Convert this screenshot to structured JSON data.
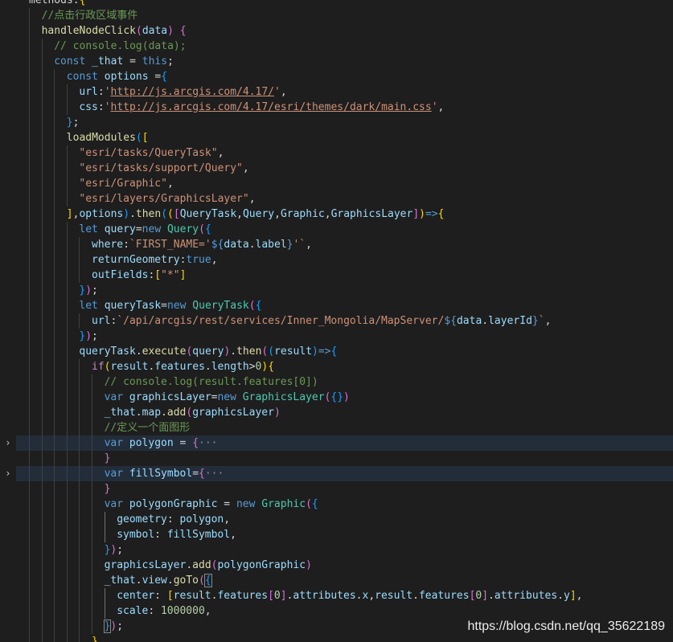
{
  "editor": {
    "lines": [
      {
        "i": 0,
        "segs": [
          [
            "op",
            "methods:"
          ],
          [
            "b1",
            "{"
          ]
        ]
      },
      {
        "i": 1,
        "segs": [
          [
            "cmt",
            "//点击行政区域事件"
          ]
        ]
      },
      {
        "i": 1,
        "segs": [
          [
            "fn",
            "handleNodeClick"
          ],
          [
            "b2",
            "("
          ],
          [
            "var",
            "data"
          ],
          [
            "b2",
            ")"
          ],
          [
            "op",
            " "
          ],
          [
            "b2",
            "{"
          ]
        ]
      },
      {
        "i": 2,
        "segs": [
          [
            "cmt",
            "// console.log(data);"
          ]
        ]
      },
      {
        "i": 2,
        "segs": [
          [
            "kw",
            "const"
          ],
          [
            "op",
            " "
          ],
          [
            "var",
            "_that"
          ],
          [
            "op",
            " = "
          ],
          [
            "kw",
            "this"
          ],
          [
            "op",
            ";"
          ]
        ]
      },
      {
        "i": 3,
        "segs": [
          [
            "kw",
            "const"
          ],
          [
            "op",
            " "
          ],
          [
            "var",
            "options"
          ],
          [
            "op",
            " ="
          ],
          [
            "b3",
            "{"
          ]
        ]
      },
      {
        "i": 4,
        "segs": [
          [
            "var",
            "url"
          ],
          [
            "op",
            ":"
          ],
          [
            "str",
            "'"
          ],
          [
            "str url",
            "http://js.arcgis.com/4.17/"
          ],
          [
            "str",
            "'"
          ],
          [
            "op",
            ","
          ]
        ]
      },
      {
        "i": 4,
        "segs": [
          [
            "var",
            "css"
          ],
          [
            "op",
            ":"
          ],
          [
            "str",
            "'"
          ],
          [
            "str url",
            "http://js.arcgis.com/4.17/esri/themes/dark/main.css"
          ],
          [
            "str",
            "'"
          ],
          [
            "op",
            ","
          ]
        ]
      },
      {
        "i": 3,
        "segs": [
          [
            "b3",
            "}"
          ],
          [
            "op",
            ";"
          ]
        ]
      },
      {
        "i": 3,
        "segs": [
          [
            "fn",
            "loadModules"
          ],
          [
            "b3",
            "("
          ],
          [
            "b1",
            "["
          ]
        ]
      },
      {
        "i": 4,
        "segs": [
          [
            "str",
            "\"esri/tasks/QueryTask\""
          ],
          [
            "op",
            ","
          ]
        ]
      },
      {
        "i": 4,
        "segs": [
          [
            "str",
            "\"esri/tasks/support/Query\""
          ],
          [
            "op",
            ","
          ]
        ]
      },
      {
        "i": 4,
        "segs": [
          [
            "str",
            "\"esri/Graphic\""
          ],
          [
            "op",
            ","
          ]
        ]
      },
      {
        "i": 4,
        "segs": [
          [
            "str",
            "\"esri/layers/GraphicsLayer\""
          ],
          [
            "op",
            ","
          ]
        ]
      },
      {
        "i": 3,
        "segs": [
          [
            "b1",
            "]"
          ],
          [
            "op",
            ","
          ],
          [
            "var",
            "options"
          ],
          [
            "b3",
            ")"
          ],
          [
            "op",
            "."
          ],
          [
            "fn",
            "then"
          ],
          [
            "b3",
            "("
          ],
          [
            "b1",
            "("
          ],
          [
            "b2",
            "["
          ],
          [
            "var",
            "QueryTask"
          ],
          [
            "op",
            ","
          ],
          [
            "var",
            "Query"
          ],
          [
            "op",
            ","
          ],
          [
            "var",
            "Graphic"
          ],
          [
            "op",
            ","
          ],
          [
            "var",
            "GraphicsLayer"
          ],
          [
            "b2",
            "]"
          ],
          [
            "b1",
            ")"
          ],
          [
            "kw",
            "=>"
          ],
          [
            "b1",
            "{"
          ]
        ]
      },
      {
        "i": 4,
        "segs": [
          [
            "kw",
            "let"
          ],
          [
            "op",
            " "
          ],
          [
            "var",
            "query"
          ],
          [
            "op",
            "="
          ],
          [
            "kw",
            "new"
          ],
          [
            "op",
            " "
          ],
          [
            "cls",
            "Query"
          ],
          [
            "b2",
            "("
          ],
          [
            "b3",
            "{"
          ]
        ]
      },
      {
        "i": 5,
        "segs": [
          [
            "var",
            "where"
          ],
          [
            "op",
            ":"
          ],
          [
            "str",
            "`FIRST_NAME='"
          ],
          [
            "kw",
            "${"
          ],
          [
            "var",
            "data"
          ],
          [
            "op",
            "."
          ],
          [
            "var",
            "label"
          ],
          [
            "kw",
            "}"
          ],
          [
            "str",
            "'`"
          ],
          [
            "op",
            ","
          ]
        ]
      },
      {
        "i": 5,
        "segs": [
          [
            "var",
            "returnGeometry"
          ],
          [
            "op",
            ":"
          ],
          [
            "kw",
            "true"
          ],
          [
            "op",
            ","
          ]
        ]
      },
      {
        "i": 5,
        "segs": [
          [
            "var",
            "outFields"
          ],
          [
            "op",
            ":"
          ],
          [
            "b1",
            "["
          ],
          [
            "str",
            "\"*\""
          ],
          [
            "b1",
            "]"
          ]
        ]
      },
      {
        "i": 4,
        "segs": [
          [
            "b3",
            "}"
          ],
          [
            "b2",
            ")"
          ],
          [
            "op",
            ";"
          ]
        ]
      },
      {
        "i": 4,
        "segs": [
          [
            "kw",
            "let"
          ],
          [
            "op",
            " "
          ],
          [
            "var",
            "queryTask"
          ],
          [
            "op",
            "="
          ],
          [
            "kw",
            "new"
          ],
          [
            "op",
            " "
          ],
          [
            "cls",
            "QueryTask"
          ],
          [
            "b2",
            "("
          ],
          [
            "b3",
            "{"
          ]
        ]
      },
      {
        "i": 5,
        "segs": [
          [
            "var",
            "url"
          ],
          [
            "op",
            ":"
          ],
          [
            "str",
            "`/api/arcgis/rest/services/Inner_Mongolia/MapServer/"
          ],
          [
            "kw",
            "${"
          ],
          [
            "var",
            "data"
          ],
          [
            "op",
            "."
          ],
          [
            "var",
            "layerId"
          ],
          [
            "kw",
            "}"
          ],
          [
            "str",
            "`"
          ],
          [
            "op",
            ","
          ]
        ]
      },
      {
        "i": 4,
        "segs": [
          [
            "b3",
            "}"
          ],
          [
            "b2",
            ")"
          ],
          [
            "op",
            ";"
          ]
        ]
      },
      {
        "i": 4,
        "segs": [
          [
            "var",
            "queryTask"
          ],
          [
            "op",
            "."
          ],
          [
            "fn",
            "execute"
          ],
          [
            "b2",
            "("
          ],
          [
            "var",
            "query"
          ],
          [
            "b2",
            ")"
          ],
          [
            "op",
            "."
          ],
          [
            "fn",
            "then"
          ],
          [
            "b2",
            "("
          ],
          [
            "b3",
            "("
          ],
          [
            "var",
            "result"
          ],
          [
            "b3",
            ")"
          ],
          [
            "kw",
            "=>"
          ],
          [
            "b3",
            "{"
          ]
        ]
      },
      {
        "i": 5,
        "segs": [
          [
            "ctl",
            "if"
          ],
          [
            "b1",
            "("
          ],
          [
            "var",
            "result"
          ],
          [
            "op",
            "."
          ],
          [
            "var",
            "features"
          ],
          [
            "op",
            "."
          ],
          [
            "var",
            "length"
          ],
          [
            "op",
            ">"
          ],
          [
            "num",
            "0"
          ],
          [
            "b1",
            ")"
          ],
          [
            "b1",
            "{"
          ]
        ]
      },
      {
        "i": 6,
        "segs": [
          [
            "cmt",
            "// console.log(result.features[0])"
          ]
        ]
      },
      {
        "i": 6,
        "segs": [
          [
            "kw",
            "var"
          ],
          [
            "op",
            " "
          ],
          [
            "var",
            "graphicsLayer"
          ],
          [
            "op",
            "="
          ],
          [
            "kw",
            "new"
          ],
          [
            "op",
            " "
          ],
          [
            "cls",
            "GraphicsLayer"
          ],
          [
            "b2",
            "("
          ],
          [
            "b3",
            "{}"
          ],
          [
            "b2",
            ")"
          ]
        ]
      },
      {
        "i": 6,
        "segs": [
          [
            "var",
            "_that"
          ],
          [
            "op",
            "."
          ],
          [
            "var",
            "map"
          ],
          [
            "op",
            "."
          ],
          [
            "fn",
            "add"
          ],
          [
            "b2",
            "("
          ],
          [
            "var",
            "graphicsLayer"
          ],
          [
            "b2",
            ")"
          ]
        ]
      },
      {
        "i": 6,
        "segs": [
          [
            "cmt",
            "//定义一个面图形"
          ]
        ]
      },
      {
        "i": 6,
        "hl": true,
        "fold": true,
        "segs": [
          [
            "kw",
            "var"
          ],
          [
            "op",
            " "
          ],
          [
            "var",
            "polygon"
          ],
          [
            "op",
            " = "
          ],
          [
            "b2",
            "{"
          ],
          [
            "ell",
            "···"
          ]
        ]
      },
      {
        "i": 6,
        "segs": [
          [
            "b2",
            "}"
          ]
        ]
      },
      {
        "i": 6,
        "hl": true,
        "fold": true,
        "segs": [
          [
            "kw",
            "var"
          ],
          [
            "op",
            " "
          ],
          [
            "var",
            "fillSymbol"
          ],
          [
            "op",
            "="
          ],
          [
            "b2",
            "{"
          ],
          [
            "ell",
            "···"
          ]
        ]
      },
      {
        "i": 6,
        "segs": [
          [
            "b2",
            "}"
          ]
        ]
      },
      {
        "i": 6,
        "segs": [
          [
            "kw",
            "var"
          ],
          [
            "op",
            " "
          ],
          [
            "var",
            "polygonGraphic"
          ],
          [
            "op",
            " = "
          ],
          [
            "kw",
            "new"
          ],
          [
            "op",
            " "
          ],
          [
            "cls",
            "Graphic"
          ],
          [
            "b2",
            "("
          ],
          [
            "b3",
            "{"
          ]
        ]
      },
      {
        "i": 7,
        "segs": [
          [
            "var",
            "geometry"
          ],
          [
            "op",
            ": "
          ],
          [
            "var",
            "polygon"
          ],
          [
            "op",
            ","
          ]
        ]
      },
      {
        "i": 7,
        "segs": [
          [
            "var",
            "symbol"
          ],
          [
            "op",
            ": "
          ],
          [
            "var",
            "fillSymbol"
          ],
          [
            "op",
            ","
          ]
        ]
      },
      {
        "i": 6,
        "segs": [
          [
            "b3",
            "}"
          ],
          [
            "b2",
            ")"
          ],
          [
            "op",
            ";"
          ]
        ]
      },
      {
        "i": 6,
        "segs": [
          [
            "var",
            "graphicsLayer"
          ],
          [
            "op",
            "."
          ],
          [
            "fn",
            "add"
          ],
          [
            "b2",
            "("
          ],
          [
            "var",
            "polygonGraphic"
          ],
          [
            "b2",
            ")"
          ]
        ]
      },
      {
        "i": 6,
        "segs": [
          [
            "var",
            "_that"
          ],
          [
            "op",
            "."
          ],
          [
            "var",
            "view"
          ],
          [
            "op",
            "."
          ],
          [
            "fn",
            "goTo"
          ],
          [
            "b2",
            "("
          ],
          [
            "b3 bmatch",
            "{"
          ]
        ]
      },
      {
        "i": 7,
        "segs": [
          [
            "var",
            "center"
          ],
          [
            "op",
            ": "
          ],
          [
            "b1",
            "["
          ],
          [
            "var",
            "result"
          ],
          [
            "op",
            "."
          ],
          [
            "var",
            "features"
          ],
          [
            "b2",
            "["
          ],
          [
            "num",
            "0"
          ],
          [
            "b2",
            "]"
          ],
          [
            "op",
            "."
          ],
          [
            "var",
            "attributes"
          ],
          [
            "op",
            "."
          ],
          [
            "var",
            "x"
          ],
          [
            "op",
            ","
          ],
          [
            "var",
            "result"
          ],
          [
            "op",
            "."
          ],
          [
            "var",
            "features"
          ],
          [
            "b2",
            "["
          ],
          [
            "num",
            "0"
          ],
          [
            "b2",
            "]"
          ],
          [
            "op",
            "."
          ],
          [
            "var",
            "attributes"
          ],
          [
            "op",
            "."
          ],
          [
            "var",
            "y"
          ],
          [
            "b1",
            "]"
          ],
          [
            "op",
            ","
          ]
        ]
      },
      {
        "i": 7,
        "segs": [
          [
            "var",
            "scale"
          ],
          [
            "op",
            ": "
          ],
          [
            "num",
            "1000000"
          ],
          [
            "op",
            ","
          ]
        ]
      },
      {
        "i": 6,
        "segs": [
          [
            "b3 bmatch",
            "}"
          ],
          [
            "b2",
            ")"
          ],
          [
            "op",
            ";"
          ]
        ]
      },
      {
        "i": 5,
        "segs": [
          [
            "b1",
            "}"
          ]
        ]
      }
    ]
  },
  "watermark": "https://blog.csdn.net/qq_35622189"
}
